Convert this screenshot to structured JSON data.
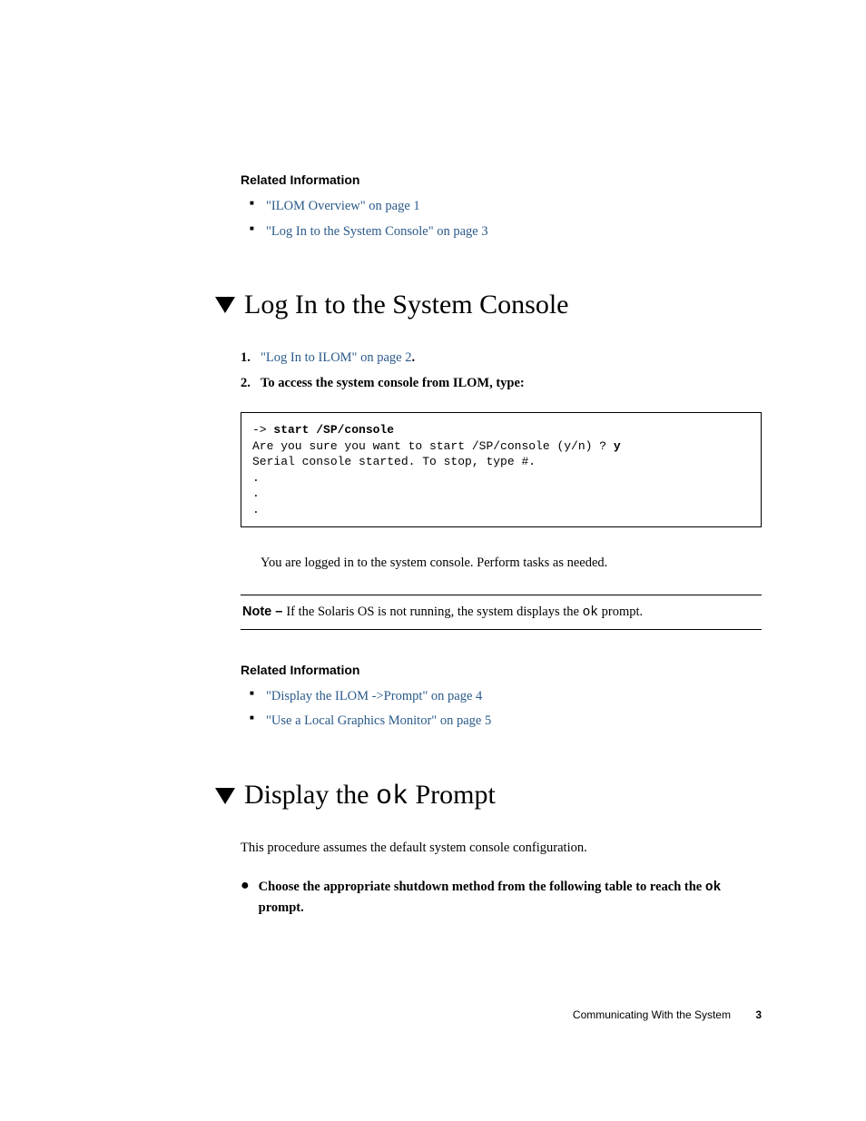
{
  "section1": {
    "heading": "Related Information",
    "items": [
      {
        "text": "\"ILOM Overview\" on page 1"
      },
      {
        "text": "\"Log In to the System Console\" on page 3"
      }
    ]
  },
  "section2": {
    "heading": "Log In to the System Console",
    "steps": [
      {
        "num": "1.",
        "link": "\"Log In to ILOM\" on page 2",
        "suffix": "."
      },
      {
        "num": "2.",
        "bold": "To access the system console from ILOM, type:"
      }
    ],
    "code": {
      "prompt": "-> ",
      "cmd": "start /SP/console",
      "line2_pre": "Are you sure you want to start /SP/console (y/n) ? ",
      "line2_bold": "y",
      "line3": "Serial console started. To stop, type #.",
      "dots": ".\n.\n."
    },
    "afterText": "You are logged in to the system console. Perform tasks as needed.",
    "note": {
      "label": "Note – ",
      "pre": "If the Solaris OS is not running, the system displays the ",
      "code": "ok",
      "post": " prompt."
    },
    "relatedHeading": "Related Information",
    "relatedItems": [
      {
        "text": "\"Display the ILOM ->Prompt\" on page 4"
      },
      {
        "text": "\"Use a Local Graphics Monitor\" on page 5"
      }
    ]
  },
  "section3": {
    "heading_pre": "Display the ",
    "heading_code": "ok",
    "heading_post": " Prompt",
    "intro": "This procedure assumes the default system console configuration.",
    "bullet_pre": "Choose the appropriate shutdown method from the following table to reach the ",
    "bullet_code": "ok",
    "bullet_post": " prompt."
  },
  "footer": {
    "text": "Communicating With the System",
    "page": "3"
  }
}
